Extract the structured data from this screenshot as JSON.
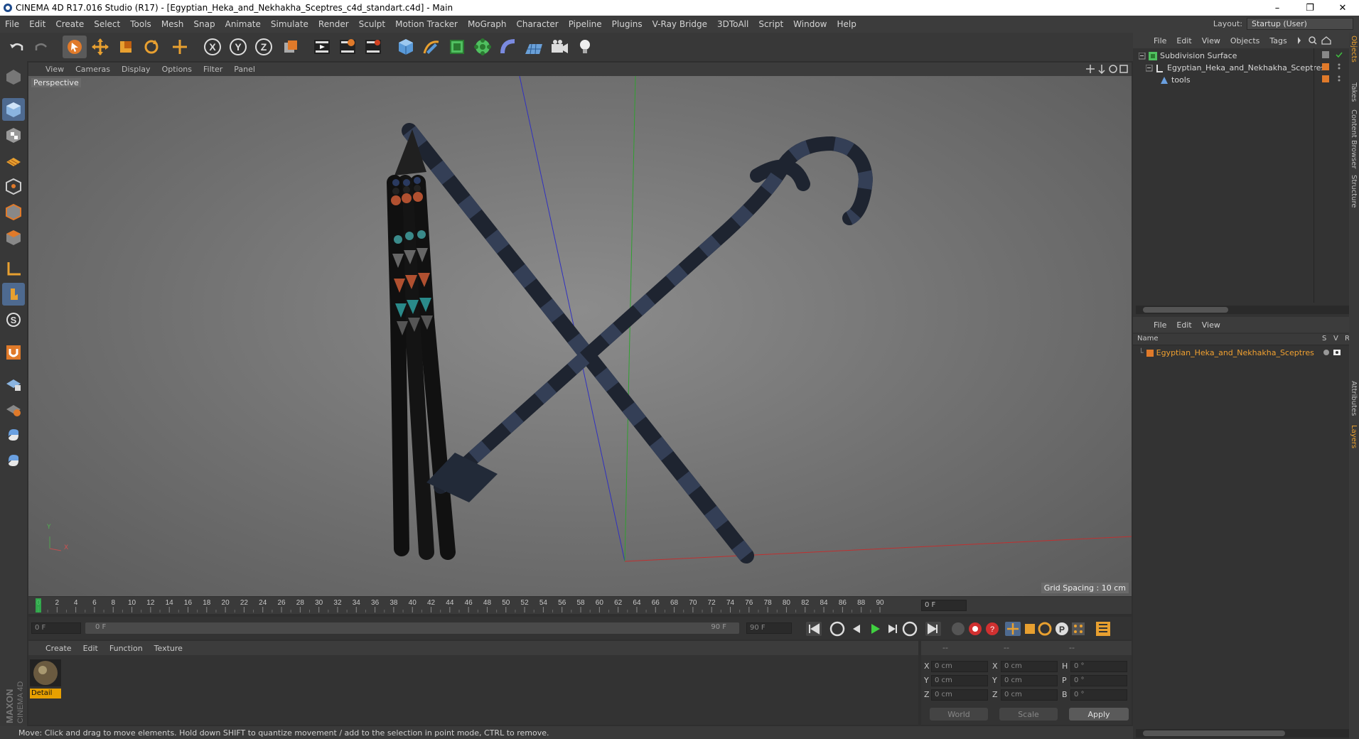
{
  "window": {
    "title": "CINEMA 4D R17.016 Studio (R17) - [Egyptian_Heka_and_Nekhakha_Sceptres_c4d_standart.c4d] - Main",
    "minimize": "–",
    "restore": "❐",
    "close": "✕"
  },
  "menubar": {
    "items": [
      "File",
      "Edit",
      "Create",
      "Select",
      "Tools",
      "Mesh",
      "Snap",
      "Animate",
      "Simulate",
      "Render",
      "Sculpt",
      "Motion Tracker",
      "MoGraph",
      "Character",
      "Pipeline",
      "Plugins",
      "V-Ray Bridge",
      "3DToAll",
      "Script",
      "Window",
      "Help"
    ],
    "layout_label": "Layout:",
    "layout_value": "Startup (User)"
  },
  "viewport": {
    "menu": [
      "View",
      "Cameras",
      "Display",
      "Options",
      "Filter",
      "Panel"
    ],
    "camera_label": "Perspective",
    "grid_spacing": "Grid Spacing : 10 cm",
    "axis_y": "Y",
    "axis_x": "X"
  },
  "timeline": {
    "ticks": [
      "0",
      "2",
      "4",
      "6",
      "8",
      "10",
      "12",
      "14",
      "16",
      "18",
      "20",
      "22",
      "24",
      "26",
      "28",
      "30",
      "32",
      "34",
      "36",
      "38",
      "40",
      "42",
      "44",
      "46",
      "48",
      "50",
      "52",
      "54",
      "56",
      "58",
      "60",
      "62",
      "64",
      "66",
      "68",
      "70",
      "72",
      "74",
      "76",
      "78",
      "80",
      "82",
      "84",
      "86",
      "88",
      "90"
    ],
    "current_frame": "0 F"
  },
  "playbar": {
    "start_frame": "0 F",
    "range_start": "0 F",
    "range_end": "90 F",
    "end_frame": "90 F"
  },
  "materials": {
    "menu": [
      "Create",
      "Edit",
      "Function",
      "Texture"
    ],
    "items": [
      {
        "name": "Detail"
      }
    ]
  },
  "coordinates": {
    "headers": [
      "--",
      "--",
      "--"
    ],
    "rows": [
      {
        "a": "X",
        "av": "0 cm",
        "b": "X",
        "bv": "0 cm",
        "c": "H",
        "cv": "0 °"
      },
      {
        "a": "Y",
        "av": "0 cm",
        "b": "Y",
        "bv": "0 cm",
        "c": "P",
        "cv": "0 °"
      },
      {
        "a": "Z",
        "av": "0 cm",
        "b": "Z",
        "bv": "0 cm",
        "c": "B",
        "cv": "0 °"
      }
    ],
    "world": "World",
    "scale": "Scale",
    "apply": "Apply"
  },
  "object_manager": {
    "menu": [
      "File",
      "Edit",
      "View",
      "Objects",
      "Tags"
    ],
    "objects": [
      {
        "name": "Subdivision Surface"
      },
      {
        "name": "Egyptian_Heka_and_Nekhakha_Sceptres"
      },
      {
        "name": "tools"
      }
    ]
  },
  "layer_manager": {
    "menu": [
      "File",
      "Edit",
      "View"
    ],
    "col_name": "Name",
    "col_s": "S",
    "col_v": "V",
    "col_r": "R",
    "layers": [
      {
        "name": "Egyptian_Heka_and_Nekhakha_Sceptres"
      }
    ]
  },
  "side_tabs": [
    "Objects",
    "Takes",
    "Content Browser",
    "Structure",
    "Attributes",
    "Layers"
  ],
  "brand": "MAXON CINEMA 4D",
  "status": "Move: Click and drag to move elements. Hold down SHIFT to quantize movement / add to the selection in point mode, CTRL to remove.",
  "colors": {
    "accent_orange": "#e07a2a",
    "selection_blue": "#4e6a90",
    "layer_text": "#f0a030"
  }
}
